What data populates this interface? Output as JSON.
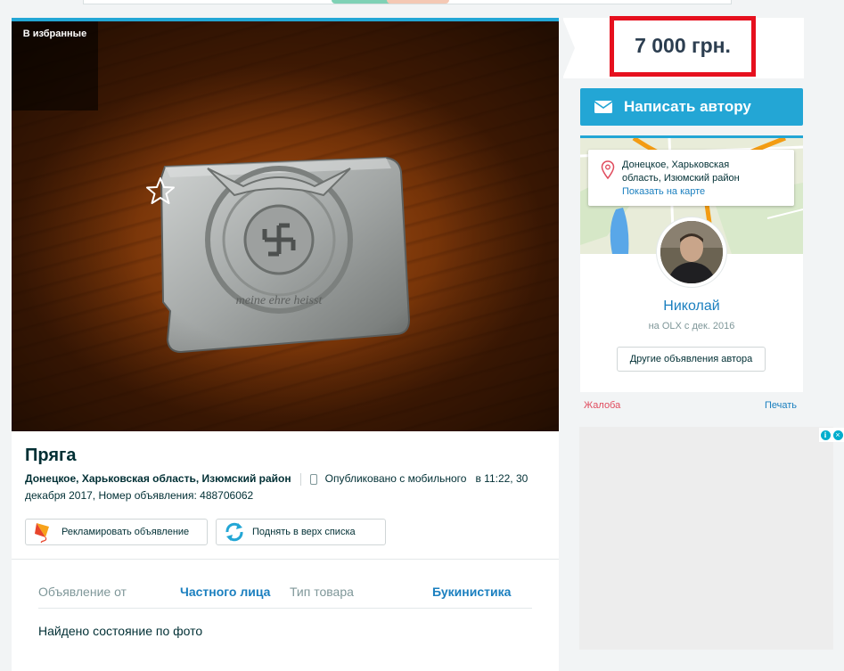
{
  "favorites": {
    "label": "В избранные",
    "icon": "star-icon"
  },
  "ad": {
    "title": "Пряга",
    "location": "Донецкое, Харьковская область, Изюмский район",
    "published_mobile": "Опубликовано с мобильного",
    "published_rest_1": "в 11:22, 30",
    "published_rest_2": "декабря 2017, Номер объявления: 488706062",
    "promote_label": "Рекламировать объявление",
    "promote_icon": "kite-icon",
    "raise_label": "Поднять в верх списка",
    "raise_icon": "refresh-arrows-icon",
    "details": [
      {
        "key": "Объявление от",
        "value": "Частного лица"
      },
      {
        "key": "Тип товара",
        "value": "Букинистика"
      }
    ],
    "description": "Найдено состояние по фото"
  },
  "sidebar": {
    "price": "7 000 грн.",
    "write_author": "Написать автору",
    "write_icon": "envelope-icon",
    "map_address": "Донецкое, Харьковская область, Изюмский район",
    "map_address_line1": "Донецкое, Харьковская",
    "map_address_line2": "область, Изюмский район",
    "show_on_map": "Показать на карте",
    "user_name": "Николай",
    "user_since": "на OLX с дек. 2016",
    "other_ads": "Другие объявления автора",
    "complain": "Жалоба",
    "print": "Печать"
  },
  "colors": {
    "accent": "#23a6d5",
    "price_highlight": "#e6101e",
    "link": "#1a7fbf"
  }
}
